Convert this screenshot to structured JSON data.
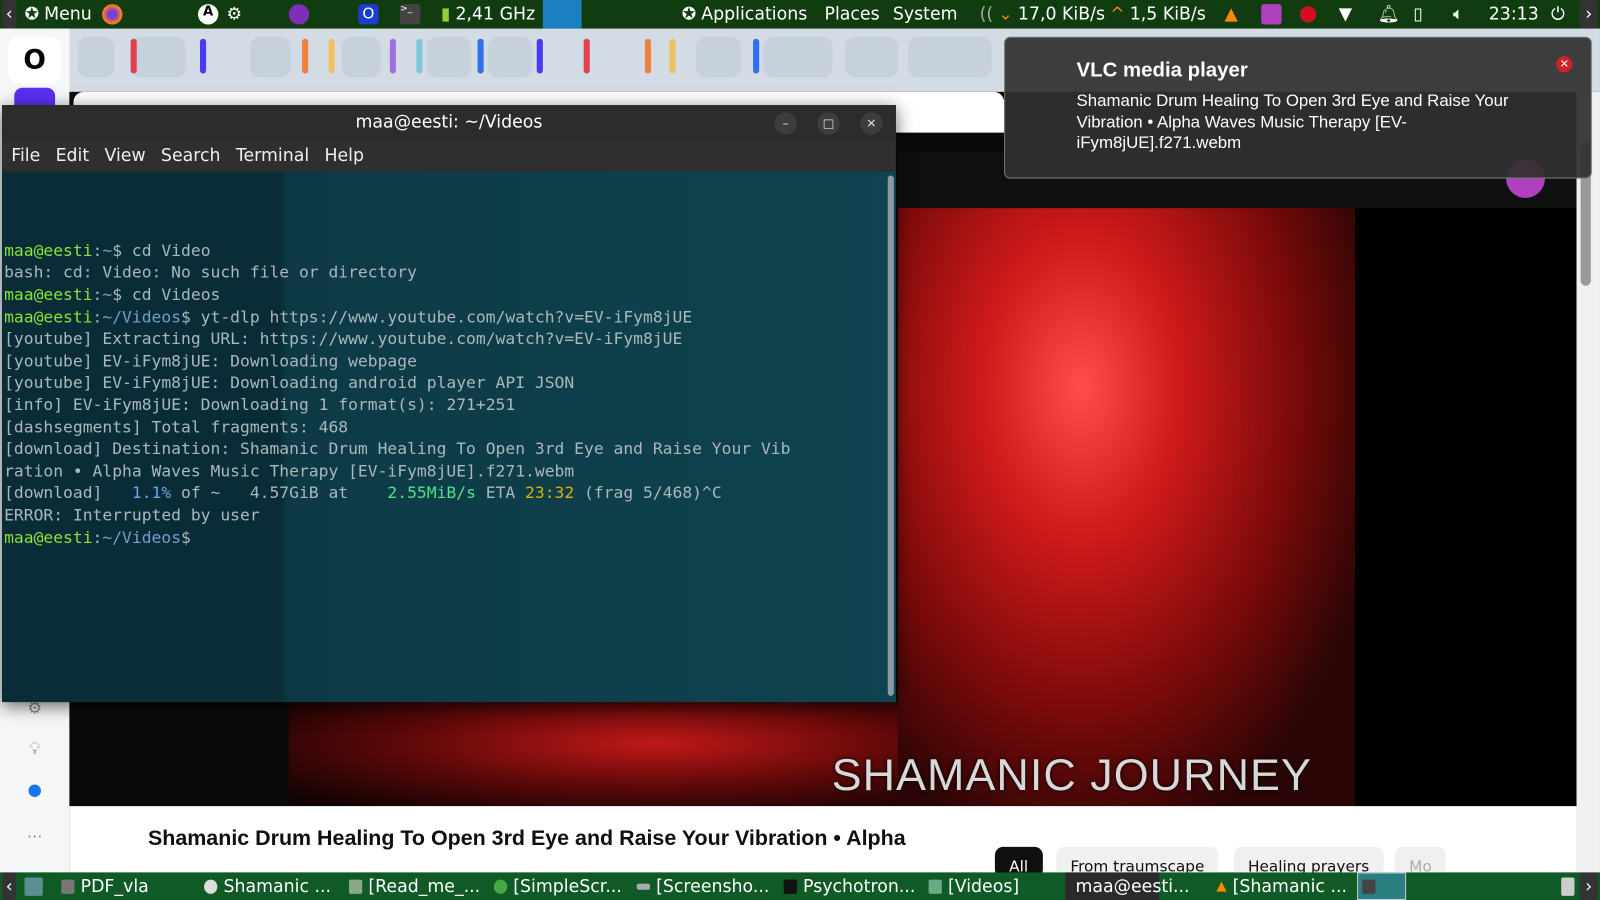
{
  "panel": {
    "menu": "Menu",
    "cpu": "2,41 GHz",
    "applications": "Applications",
    "places": "Places",
    "system": "System",
    "net_down": "17,0 KiB/s",
    "net_up": "1,5 KiB/s",
    "clock": "23:13"
  },
  "browser": {
    "video_overlay_title": "SHAMANIC JOURNEY",
    "video_title": "Shamanic Drum Healing To Open 3rd Eye and Raise Your Vibration • Alpha",
    "chips": [
      "All",
      "From traumscape",
      "Healing prayers",
      "Mo"
    ]
  },
  "terminal": {
    "title": "maa@eesti: ~/Videos",
    "menu": [
      "File",
      "Edit",
      "View",
      "Search",
      "Terminal",
      "Help"
    ],
    "colors": {
      "prompt": "#8ae234",
      "path": "#729fcf",
      "text": "#aab8bc",
      "pct": "#6aa5e8",
      "speed": "#4ee28a",
      "eta": "#e0b000"
    },
    "lines": [
      [
        {
          "t": "maa@eesti",
          "c": "prompt"
        },
        {
          "t": ":",
          "c": "text"
        },
        {
          "t": "~",
          "c": "path"
        },
        {
          "t": "$ cd Video",
          "c": "text"
        }
      ],
      [
        {
          "t": "bash: cd: Video: No such file or directory",
          "c": "text"
        }
      ],
      [
        {
          "t": "maa@eesti",
          "c": "prompt"
        },
        {
          "t": ":",
          "c": "text"
        },
        {
          "t": "~",
          "c": "path"
        },
        {
          "t": "$ cd Videos",
          "c": "text"
        }
      ],
      [
        {
          "t": "maa@eesti",
          "c": "prompt"
        },
        {
          "t": ":",
          "c": "text"
        },
        {
          "t": "~/Videos",
          "c": "path"
        },
        {
          "t": "$ yt-dlp https://www.youtube.com/watch?v=EV-iFym8jUE",
          "c": "text"
        }
      ],
      [
        {
          "t": "[youtube] Extracting URL: https://www.youtube.com/watch?v=EV-iFym8jUE",
          "c": "text"
        }
      ],
      [
        {
          "t": "[youtube] EV-iFym8jUE: Downloading webpage",
          "c": "text"
        }
      ],
      [
        {
          "t": "[youtube] EV-iFym8jUE: Downloading android player API JSON",
          "c": "text"
        }
      ],
      [
        {
          "t": "[info] EV-iFym8jUE: Downloading 1 format(s): 271+251",
          "c": "text"
        }
      ],
      [
        {
          "t": "[dashsegments] Total fragments: 468",
          "c": "text"
        }
      ],
      [
        {
          "t": "[download] Destination: Shamanic Drum Healing To Open 3rd Eye and Raise Your Vib",
          "c": "text"
        }
      ],
      [
        {
          "t": "ration • Alpha Waves Music Therapy [EV-iFym8jUE].f271.webm",
          "c": "text"
        }
      ],
      [
        {
          "t": "[download]   ",
          "c": "text"
        },
        {
          "t": "1.1%",
          "c": "pct"
        },
        {
          "t": " of ~   4.57GiB at    ",
          "c": "text"
        },
        {
          "t": "2.55MiB/s",
          "c": "speed"
        },
        {
          "t": " ETA ",
          "c": "text"
        },
        {
          "t": "23:32",
          "c": "eta"
        },
        {
          "t": " (frag 5/468)^C",
          "c": "text"
        }
      ],
      [
        {
          "t": "ERROR: Interrupted by user",
          "c": "text"
        }
      ],
      [
        {
          "t": "maa@eesti",
          "c": "prompt"
        },
        {
          "t": ":",
          "c": "text"
        },
        {
          "t": "~/Videos",
          "c": "path"
        },
        {
          "t": "$",
          "c": "text"
        }
      ]
    ]
  },
  "notification": {
    "title": "VLC media player",
    "body": "Shamanic Drum Healing To Open 3rd Eye and Raise Your Vibration • Alpha Waves Music Therapy [EV-iFym8jUE].f271.webm"
  },
  "taskbar": {
    "items": [
      "PDF_vla",
      "Shamanic ...",
      "[Read_me_...",
      "[SimpleScr...",
      "[Screensho...",
      "Psychotron...",
      "[Videos]",
      "maa@eesti...",
      "[Shamanic ..."
    ]
  }
}
